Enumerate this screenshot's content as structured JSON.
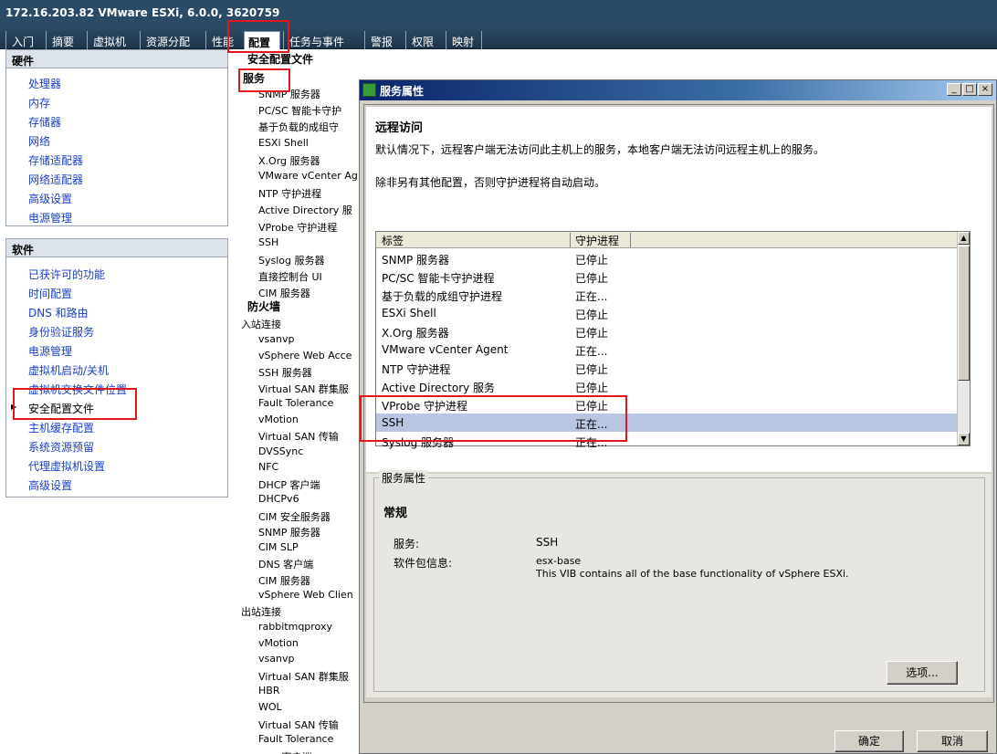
{
  "window": {
    "title": "172.16.203.82 VMware ESXi, 6.0.0, 3620759"
  },
  "tabs": [
    "入门",
    "摘要",
    "虚拟机",
    "资源分配",
    "性能",
    "配置",
    "任务与事件",
    "警报",
    "权限",
    "映射"
  ],
  "left": {
    "hardware": {
      "header": "硬件",
      "items": [
        "处理器",
        "内存",
        "存储器",
        "网络",
        "存储适配器",
        "网络适配器",
        "高级设置",
        "电源管理"
      ]
    },
    "software": {
      "header": "软件",
      "items": [
        "已获许可的功能",
        "时间配置",
        "DNS 和路由",
        "身份验证服务",
        "电源管理",
        "虚拟机启动/关机",
        "虚拟机交换文件位置",
        "安全配置文件",
        "主机缓存配置",
        "系统资源预留",
        "代理虚拟机设置",
        "高级设置"
      ]
    }
  },
  "middle": {
    "page_title": "安全配置文件",
    "services_header": "服务",
    "services": [
      "SNMP 服务器",
      "PC/SC 智能卡守护",
      "基于负载的成组守",
      "ESXi Shell",
      "X.Org 服务器",
      "VMware vCenter Ag",
      "NTP 守护进程",
      "Active Directory 服",
      "VProbe 守护进程",
      "SSH",
      "Syslog 服务器",
      "直接控制台 UI",
      "CIM 服务器"
    ],
    "firewall_header": "防火墙",
    "inbound_header": "入站连接",
    "inbound": [
      "vsanvp",
      "vSphere Web Acce",
      "SSH 服务器",
      "Virtual SAN 群集服",
      "Fault Tolerance",
      "vMotion",
      "Virtual SAN 传输",
      "DVSSync",
      "NFC",
      "DHCP 客户端",
      "DHCPv6",
      "CIM 安全服务器",
      "SNMP 服务器",
      "CIM SLP",
      "DNS 客户端",
      "CIM 服务器",
      "vSphere Web Clien"
    ],
    "outbound_header": "出站连接",
    "outbound": [
      "rabbitmqproxy",
      "vMotion",
      "vsanvp",
      "Virtual SAN 群集服",
      "HBR",
      "WOL",
      "Virtual SAN 传输",
      "Fault Tolerance",
      "…… 客户端"
    ]
  },
  "dialog": {
    "title": "服务属性",
    "remote_access_title": "远程访问",
    "desc1": "默认情况下，远程客户端无法访问此主机上的服务，本地客户端无法访问远程主机上的服务。",
    "desc2": "除非另有其他配置，否则守护进程将自动启动。",
    "grid": {
      "headers": [
        "标签",
        "守护进程"
      ],
      "rows": [
        {
          "label": "SNMP 服务器",
          "status": "已停止"
        },
        {
          "label": "PC/SC 智能卡守护进程",
          "status": "已停止"
        },
        {
          "label": "基于负载的成组守护进程",
          "status": "正在..."
        },
        {
          "label": "ESXi Shell",
          "status": "已停止"
        },
        {
          "label": "X.Org 服务器",
          "status": "已停止"
        },
        {
          "label": "VMware vCenter Agent",
          "status": "正在..."
        },
        {
          "label": "NTP 守护进程",
          "status": "已停止"
        },
        {
          "label": "Active Directory 服务",
          "status": "已停止"
        },
        {
          "label": "VProbe 守护进程",
          "status": "已停止"
        },
        {
          "label": "SSH",
          "status": "正在..."
        },
        {
          "label": "Syslog 服务器",
          "status": "正在..."
        }
      ],
      "selected_index": 9
    },
    "svc_props_legend": "服务属性",
    "general_title": "常规",
    "service_label": "服务:",
    "service_value": "SSH",
    "package_label": "软件包信息:",
    "package_value": "esx-base",
    "package_desc": "This VIB contains all of the base functionality of vSphere ESXi.",
    "options_button": "选项...",
    "ok_button": "确定",
    "cancel_button": "取消",
    "window_buttons": [
      "_",
      "□",
      "×"
    ]
  },
  "colors": {
    "highlight": "#e0181e",
    "selection": "#b8c6e1",
    "link": "#1a3fc4"
  }
}
